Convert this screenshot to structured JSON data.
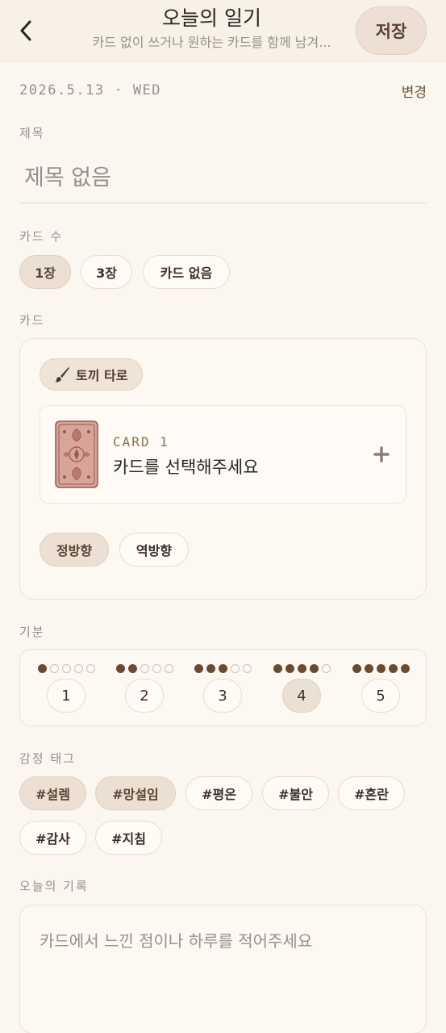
{
  "header": {
    "title": "오늘의 일기",
    "subtitle": "카드 없이 쓰거나 원하는 카드를 함께 남겨...",
    "save_label": "저장"
  },
  "date": {
    "value": "2026.5.13 · WED",
    "change_label": "변경"
  },
  "title_section": {
    "label": "제목",
    "placeholder": "제목 없음"
  },
  "card_count": {
    "label": "카드 수",
    "options": [
      "1장",
      "3장",
      "카드 없음"
    ],
    "selected": "1장"
  },
  "cards": {
    "label": "카드",
    "deck_name": "토끼 타로",
    "deck_icon": "brush-icon",
    "slot": {
      "number": "CARD 1",
      "prompt": "카드를 선택해주세요",
      "add_icon": "plus-icon"
    },
    "orientation": {
      "options": [
        "정방향",
        "역방향"
      ],
      "selected": "정방향"
    }
  },
  "mood": {
    "label": "기분",
    "levels": [
      "1",
      "2",
      "3",
      "4",
      "5"
    ],
    "selected": "4"
  },
  "emotion_tags": {
    "label": "감정 태그",
    "tags": [
      "#설렘",
      "#망설임",
      "#평온",
      "#불안",
      "#혼란",
      "#감사",
      "#지침"
    ],
    "selected": [
      "#설렘",
      "#망설임"
    ]
  },
  "record": {
    "label": "오늘의 기록",
    "placeholder": "카드에서 느낀 점이나 하루를 적어주세요"
  },
  "colors": {
    "background": "#fbf6f0",
    "accent": "#6b4a32",
    "selected_fill": "#ebe0d3",
    "muted_text": "#9a8f85"
  }
}
